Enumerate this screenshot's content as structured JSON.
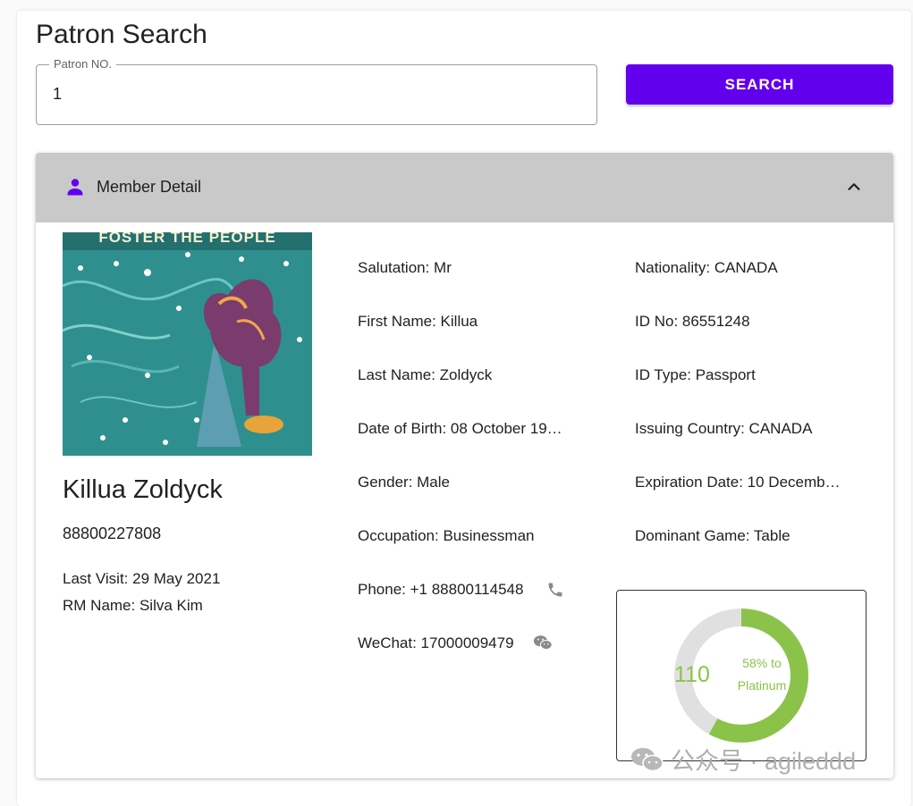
{
  "page": {
    "title": "Patron Search"
  },
  "search": {
    "field_label": "Patron NO.",
    "value": "1",
    "button_label": "SEARCH"
  },
  "member_panel": {
    "title": "Member Detail",
    "avatar_banner": "FOSTER THE PEOPLE SUPERMODEL",
    "name": "Killua Zoldyck",
    "number": "88800227808",
    "last_visit": "Last Visit: 29 May 2021",
    "rm_name": "RM Name: Silva Kim",
    "details_left": [
      "Salutation: Mr",
      "First Name: Killua",
      "Last Name: Zoldyck",
      "Date of Birth: 08 October 19…",
      "Gender: Male",
      "Occupation: Businessman",
      "Phone: +1 88800114548",
      "WeChat: 17000009479"
    ],
    "details_right": [
      "Nationality: CANADA",
      "ID No: 86551248",
      "ID Type: Passport",
      "Issuing Country: CANADA",
      "Expiration Date: 10 Decemb…",
      "Dominant Game: Table"
    ],
    "tier": {
      "points": "110",
      "progress_text": "58% to Platinum",
      "progress_percent": 58,
      "progress_color": "#8bc34a",
      "track_color": "#e0e0e0"
    }
  },
  "colors": {
    "primary": "#6200ee",
    "header_bg": "#c9c9c9"
  },
  "icons": [
    "person-icon",
    "chevron-up-icon",
    "phone-icon",
    "wechat-icon"
  ],
  "watermark": {
    "text": "公众号 · agileddd"
  }
}
